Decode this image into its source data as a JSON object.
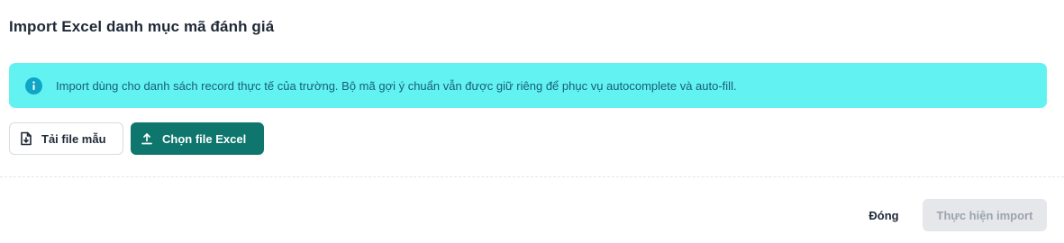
{
  "dialog": {
    "title": "Import Excel danh mục mã đánh giá"
  },
  "alert": {
    "icon": "info-icon",
    "text": "Import dùng cho danh sách record thực tế của trường. Bộ mã gợi ý chuẩn vẫn được giữ riêng để phục vụ autocomplete và auto-fill.",
    "background": "#63f2f2",
    "text_color": "#155e75"
  },
  "actions": {
    "download_template": {
      "label": "Tải file mẫu",
      "icon": "file-download-icon"
    },
    "choose_file": {
      "label": "Chọn file Excel",
      "icon": "upload-icon",
      "background": "#0f766e"
    }
  },
  "footer": {
    "close_label": "Đóng",
    "import_label": "Thực hiện import",
    "import_disabled": true
  }
}
